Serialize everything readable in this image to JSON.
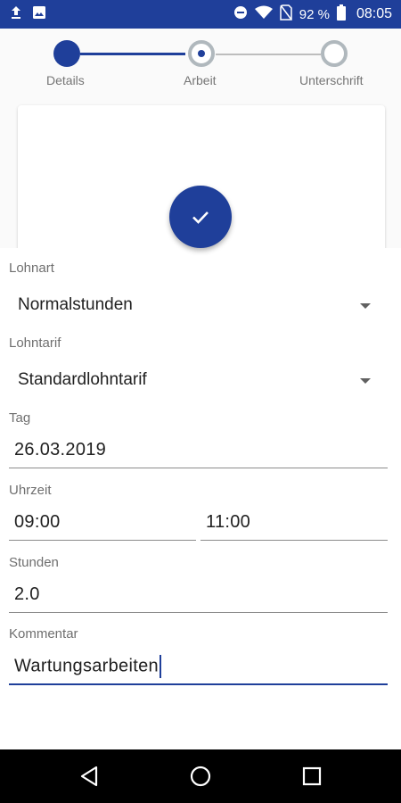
{
  "status_bar": {
    "battery": "92 %",
    "time": "08:05",
    "icons": [
      "upload-icon",
      "image-icon",
      "do-not-disturb-icon",
      "wifi-icon",
      "no-sim-icon",
      "battery-icon"
    ]
  },
  "stepper": {
    "steps": [
      {
        "label": "Details",
        "state": "done"
      },
      {
        "label": "Arbeit",
        "state": "active"
      },
      {
        "label": "Unterschrift",
        "state": "todo"
      }
    ]
  },
  "fab": {
    "icon": "check-icon"
  },
  "form": {
    "lohnart": {
      "label": "Lohnart",
      "value": "Normalstunden"
    },
    "lohntarif": {
      "label": "Lohntarif",
      "value": "Standardlohntarif"
    },
    "tag": {
      "label": "Tag",
      "value": "26.03.2019"
    },
    "uhrzeit": {
      "label": "Uhrzeit",
      "from": "09:00",
      "to": "11:00"
    },
    "stunden": {
      "label": "Stunden",
      "value": "2.0"
    },
    "kommentar": {
      "label": "Kommentar",
      "value": "Wartungsarbeiten"
    }
  },
  "nav_bar": {
    "icons": [
      "back-icon",
      "home-icon",
      "recents-icon"
    ]
  },
  "colors": {
    "primary": "#1f3f9a",
    "inactive_step": "#b0b8bd",
    "label": "#6f6f6f"
  }
}
